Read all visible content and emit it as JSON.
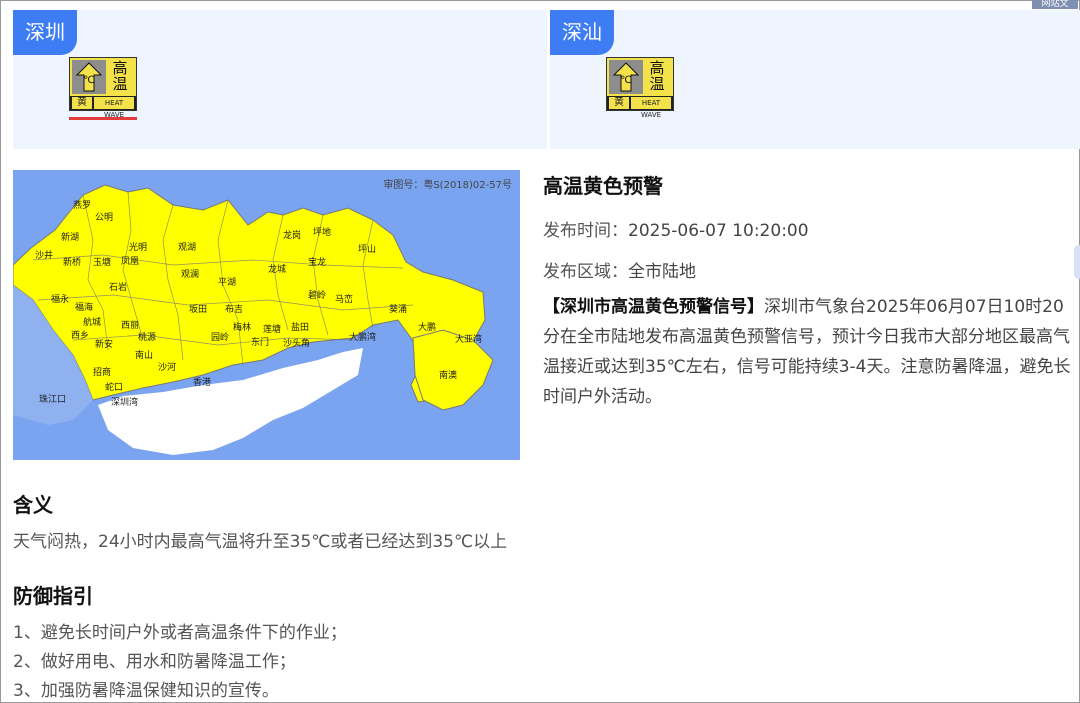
{
  "corner_tag": "网站文",
  "cards": [
    {
      "city": "深圳",
      "signal": {
        "top_text": "高温",
        "unit": "℃",
        "color": "黄",
        "wave": "HEAT WAVE"
      },
      "active": true
    },
    {
      "city": "深汕",
      "signal": {
        "top_text": "高温",
        "unit": "℃",
        "color": "黄",
        "wave": "HEAT WAVE"
      },
      "active": false
    }
  ],
  "map": {
    "review_no": "审图号：粤S(2018)02-57号",
    "labels": [
      "燕罗",
      "公明",
      "光明",
      "新湖",
      "沙井",
      "新桥",
      "玉塘",
      "凤凰",
      "石岩",
      "观湖",
      "观澜",
      "平湖",
      "坂田",
      "布吉",
      "龙城",
      "龙岗",
      "宝龙",
      "坪地",
      "坪山",
      "碧岭",
      "马峦",
      "葵涌",
      "大鹏",
      "南澳",
      "福永",
      "福海",
      "航城",
      "西乡",
      "新安",
      "西丽",
      "桃源",
      "南山",
      "沙河",
      "招商",
      "蛇口",
      "梅林",
      "园岭",
      "东门",
      "莲塘",
      "沙头角",
      "盐田",
      "大鹏湾",
      "大亚湾",
      "珠江口",
      "深圳湾",
      "香港"
    ]
  },
  "alert": {
    "title": "高温黄色预警",
    "publish_label": "发布时间：",
    "publish_time": "2025-06-07 10:20:00",
    "area_label": "发布区域：",
    "area": "全市陆地",
    "desc_title": "【深圳市高温黄色预警信号】",
    "desc_body": "深圳市气象台2025年06月07日10时20分在全市陆地发布高温黄色预警信号，预计今日我市大部分地区最高气温接近或达到35℃左右，信号可能持续3-4天。注意防暑降温，避免长时间户外活动。"
  },
  "meaning": {
    "title": "含义",
    "text": "天气闷热，24小时内最高气温将升至35℃或者已经达到35℃以上"
  },
  "guide": {
    "title": "防御指引",
    "items": [
      "1、避免长时间户外或者高温条件下的作业；",
      "2、做好用电、用水和防暑降温工作；",
      "3、加强防暑降温保健知识的宣传。"
    ]
  },
  "colors": {
    "accent": "#3d7cf2",
    "card_bg": "#eef5ff",
    "land_yellow": "#ffff00",
    "sea_blue": "#7aa4f0",
    "underline_red": "#e23c3c"
  }
}
